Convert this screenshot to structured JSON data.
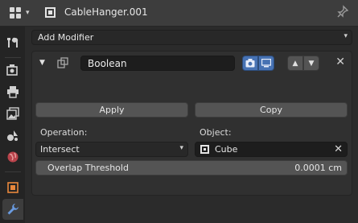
{
  "header": {
    "object_name": "CableHanger.001",
    "editor_type_icon": "properties-editor-icon",
    "pin_icon": "pin-icon"
  },
  "tabs": [
    {
      "name": "tool-tab",
      "icon": "wrench-screwdriver-icon",
      "active": false
    },
    {
      "name": "render-tab",
      "icon": "camera-back-icon",
      "active": false
    },
    {
      "name": "output-tab",
      "icon": "printer-icon",
      "active": false
    },
    {
      "name": "view-layer-tab",
      "icon": "image-stack-icon",
      "active": false
    },
    {
      "name": "scene-tab",
      "icon": "scene-icon",
      "active": false
    },
    {
      "name": "world-tab",
      "icon": "world-icon",
      "active": false
    },
    {
      "name": "object-tab",
      "icon": "object-icon",
      "active": false
    },
    {
      "name": "modifier-tab",
      "icon": "wrench-icon",
      "active": true
    }
  ],
  "add_modifier": {
    "label": "Add Modifier"
  },
  "modifier": {
    "name": "Boolean",
    "apply_label": "Apply",
    "copy_label": "Copy",
    "operation_label": "Operation:",
    "operation_value": "Intersect",
    "object_label": "Object:",
    "object_value": "Cube",
    "overlap_label": "Overlap Threshold",
    "overlap_value": "0.0001 cm"
  },
  "colors": {
    "accent": "#4772b3",
    "panel_bg": "#303030",
    "header_bg": "#3d3d3d",
    "button_bg": "#545454"
  }
}
